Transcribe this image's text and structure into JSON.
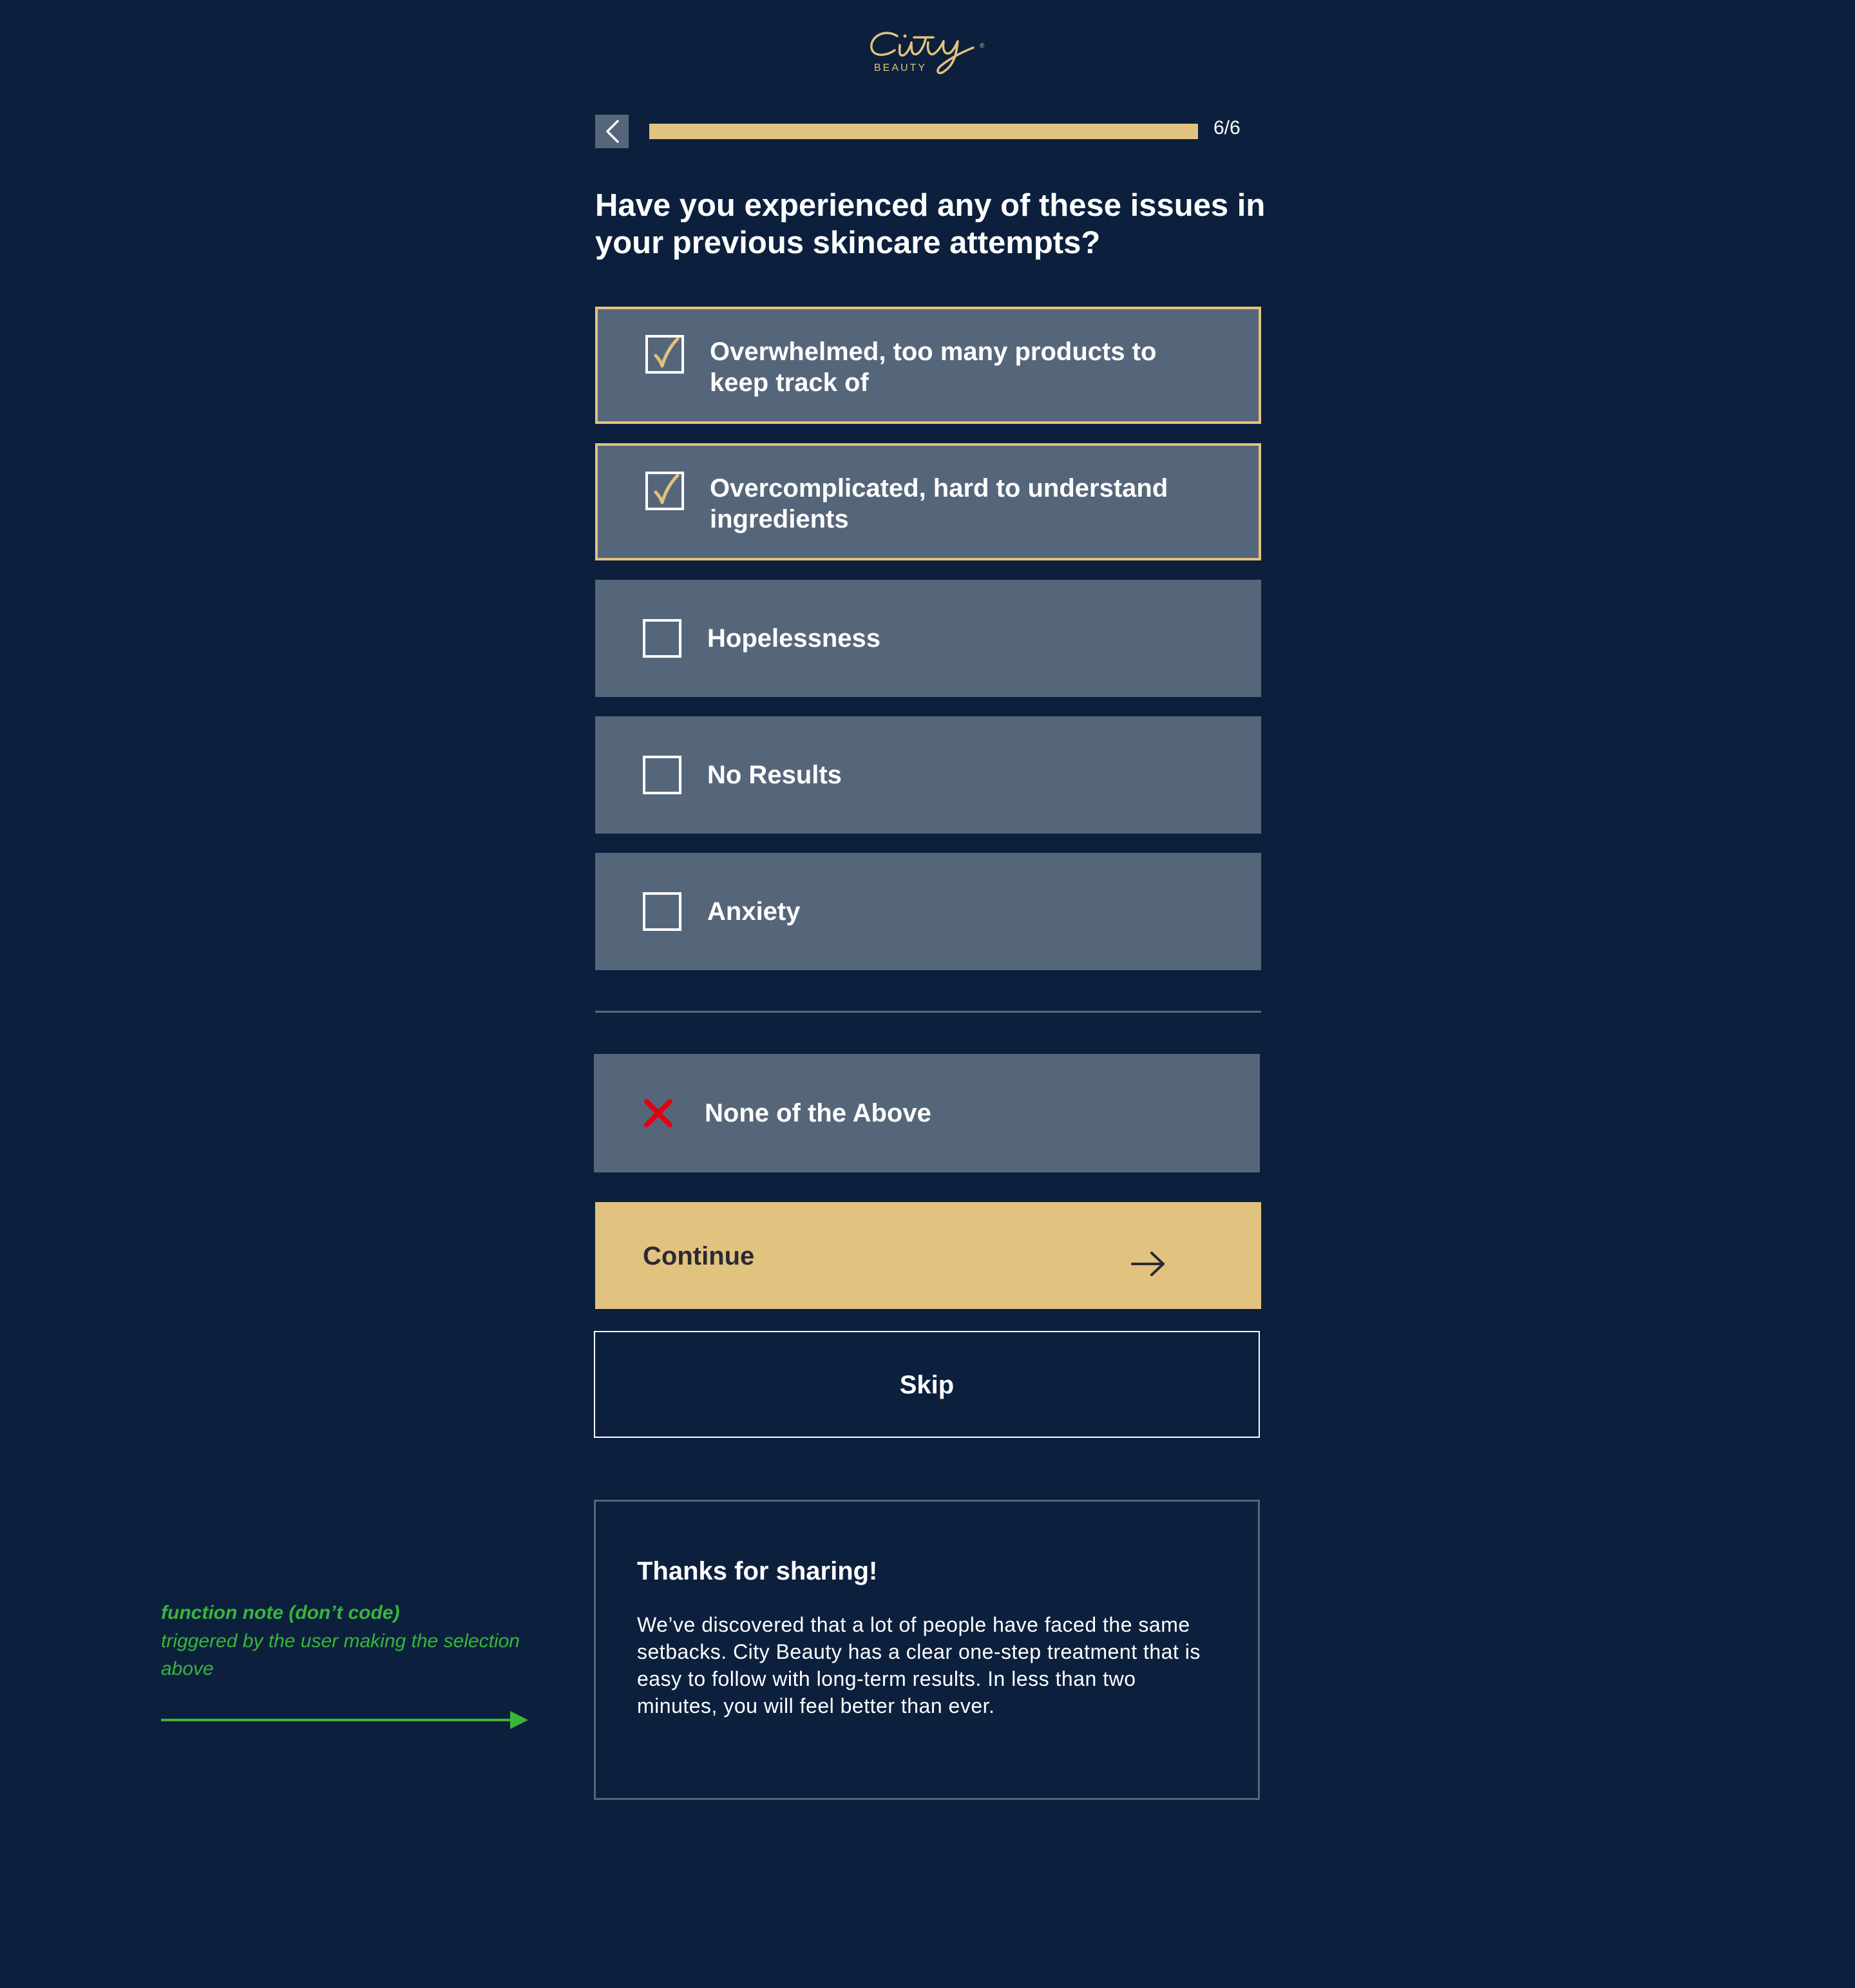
{
  "brand": {
    "logo_script": "City",
    "logo_sub": "BEAUTY",
    "logo_mark": "®",
    "gold": "#e1c27f",
    "navy": "#0c203d",
    "card": "#56667a"
  },
  "header": {
    "back_icon": "chevron-left-icon",
    "progress_fraction": 1.0,
    "progress_text": "6/6"
  },
  "question": "Have you experienced any of these issues in your previous skincare attempts?",
  "options": [
    {
      "label": "Overwhelmed, too many products to keep track of",
      "selected": true
    },
    {
      "label": "Overcomplicated, hard to understand ingredients",
      "selected": true
    },
    {
      "label": "Hopelessness",
      "selected": false
    },
    {
      "label": "No Results",
      "selected": false
    },
    {
      "label": "Anxiety",
      "selected": false
    }
  ],
  "none_option": {
    "label": "None of the Above",
    "icon": "x-icon",
    "icon_color": "#e3000f"
  },
  "continue_button": {
    "label": "Continue",
    "icon": "arrow-right-icon"
  },
  "skip_button": {
    "label": "Skip"
  },
  "feedback": {
    "title": "Thanks for sharing!",
    "body": "We’ve discovered that a lot of people have faced the same setbacks. City Beauty has a clear one-step treatment that is easy to follow with long-term results. In less than two minutes, you will feel better than ever."
  },
  "annotation": {
    "title": "function note (don’t code)",
    "body": "triggered by the user making the selection above",
    "color": "#38b53a"
  }
}
